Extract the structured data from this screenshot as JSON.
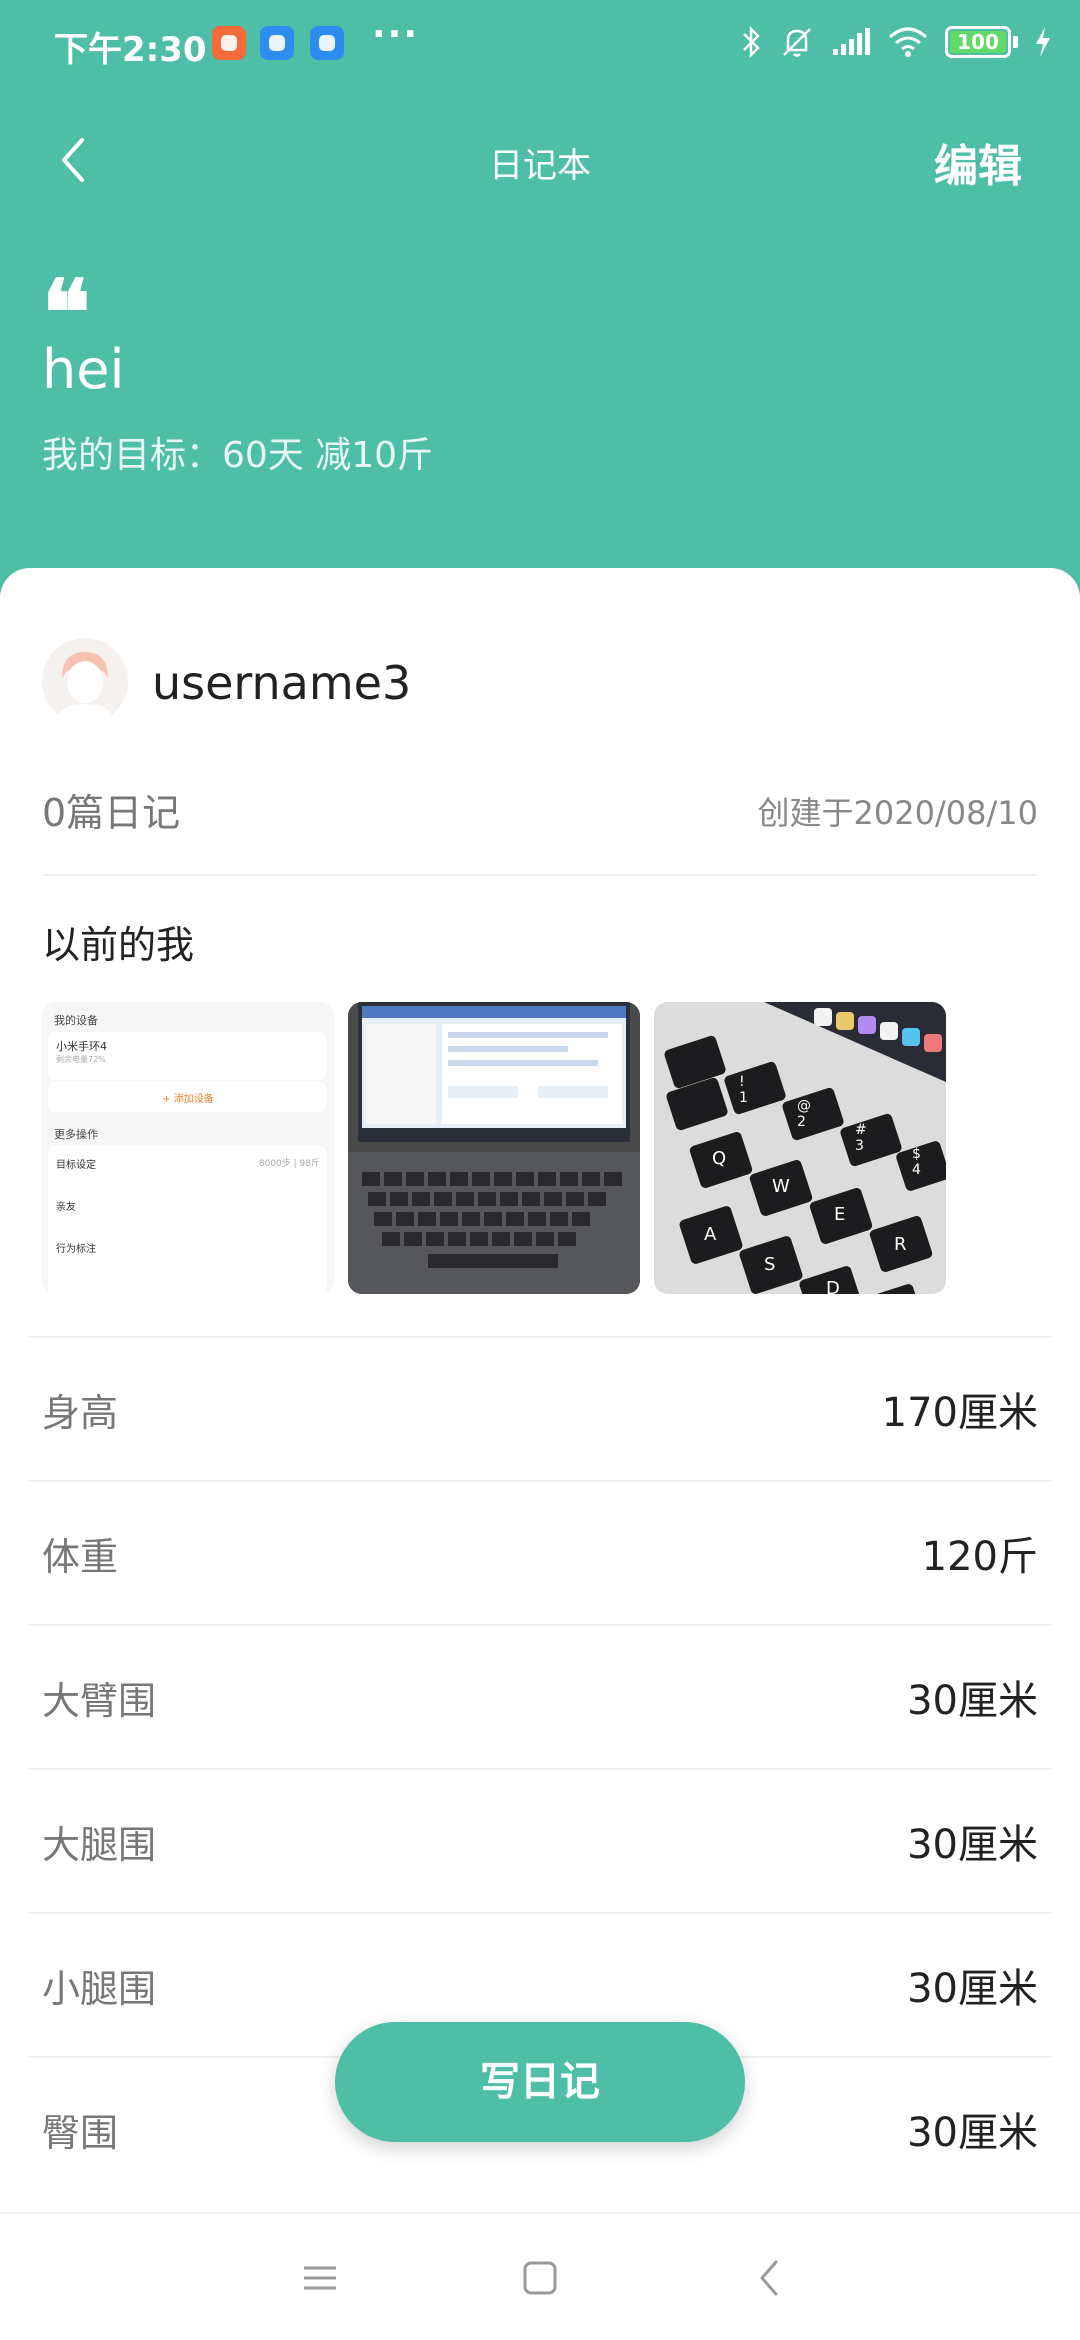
{
  "status_bar": {
    "time": "下午2:30",
    "more": "···",
    "battery": "100"
  },
  "nav": {
    "title": "日记本",
    "edit": "编辑"
  },
  "diary": {
    "quote_mark": "❝",
    "title": "hei",
    "goal": "我的目标：60天 减10斤"
  },
  "profile": {
    "username": "username3",
    "diary_count": "0篇日记",
    "created": "创建于2020/08/10"
  },
  "before": {
    "title": "以前的我",
    "photo1": {
      "my_devices": "我的设备",
      "device_name": "小米手环4",
      "device_sub": "剩余电量72%",
      "add_device": "+ 添加设备",
      "more_ops": "更多操作",
      "goal_label": "目标设定",
      "goal_value": "8000步 | 98斤",
      "friends": "亲友",
      "behavior": "行为标注"
    },
    "photo3": {
      "keys_row1": [
        "!",
        "@",
        "#",
        "$"
      ],
      "nums_row1": [
        "1",
        "2",
        "3",
        "4"
      ],
      "keys_row2": [
        "Q",
        "W",
        "E",
        "R"
      ],
      "keys_row3": [
        "A",
        "S",
        "D"
      ]
    }
  },
  "metrics": [
    {
      "label": "身高",
      "value": "170厘米"
    },
    {
      "label": "体重",
      "value": "120斤"
    },
    {
      "label": "大臂围",
      "value": "30厘米"
    },
    {
      "label": "大腿围",
      "value": "30厘米"
    },
    {
      "label": "小腿围",
      "value": "30厘米"
    },
    {
      "label": "臀围",
      "value": "30厘米"
    }
  ],
  "fab": {
    "label": "写日记"
  },
  "colors": {
    "accent": "#4fbea6"
  }
}
